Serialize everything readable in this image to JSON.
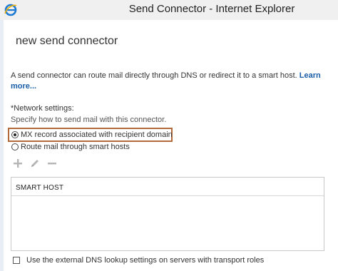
{
  "window": {
    "title": "Send Connector - Internet Explorer",
    "icon": "internet-explorer-icon"
  },
  "page": {
    "heading": "new send connector",
    "description": "A send connector can route mail directly through DNS or redirect it to a smart host.",
    "learn_more": "Learn more..."
  },
  "network_settings": {
    "label": "*Network settings:",
    "sublabel": "Specify how to send mail with this connector.",
    "options": [
      {
        "label": "MX record associated with recipient domain",
        "checked": true
      },
      {
        "label": "Route mail through smart hosts",
        "checked": false
      }
    ],
    "highlight_color": "#b36a3a"
  },
  "toolbar": {
    "icons": [
      "add-icon",
      "edit-icon",
      "remove-icon"
    ]
  },
  "smart_host_table": {
    "columns": [
      "SMART HOST"
    ],
    "rows": []
  },
  "external_dns": {
    "label": "Use the external DNS lookup settings on servers with transport roles",
    "checked": false
  },
  "colors": {
    "link": "#1a5ea8",
    "icon_disabled": "#b5b5b5"
  }
}
